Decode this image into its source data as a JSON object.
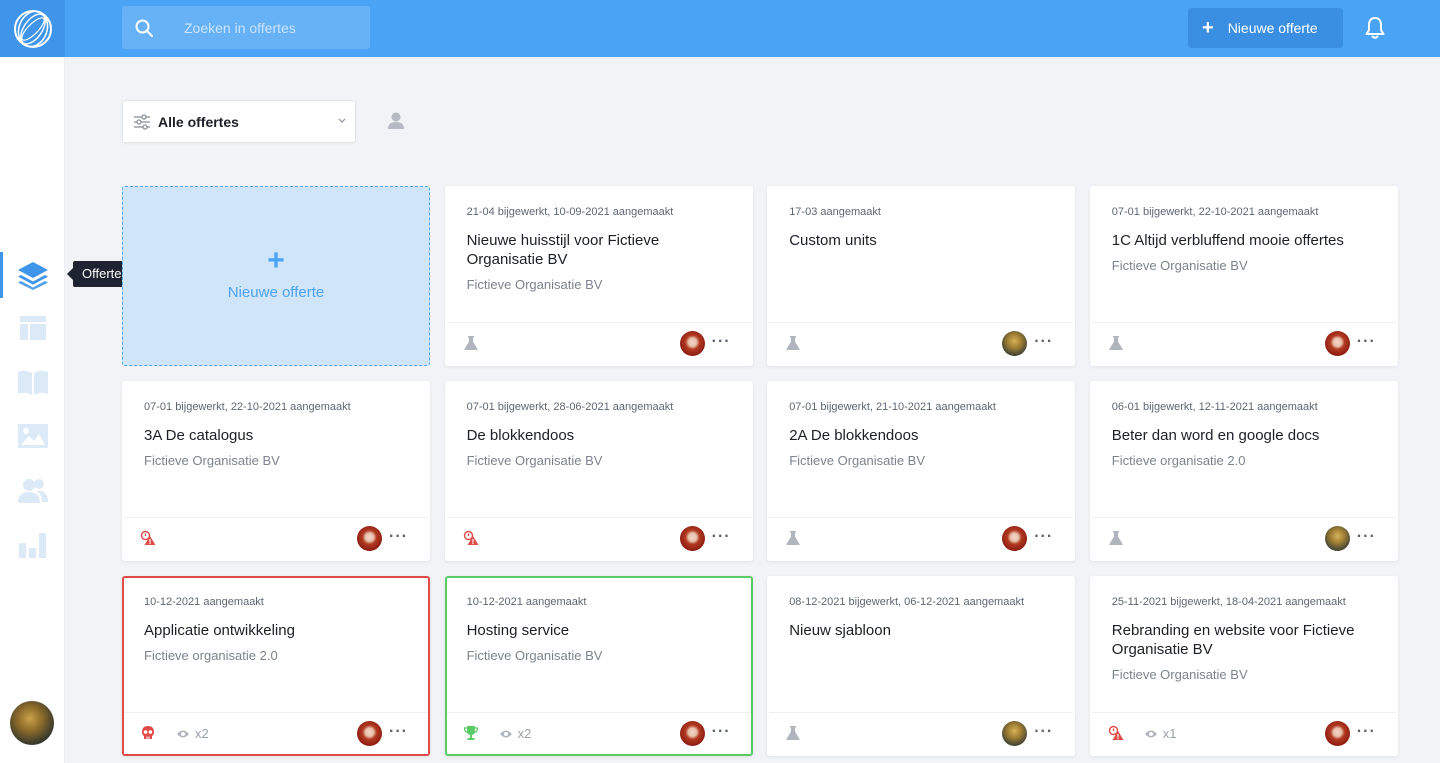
{
  "topbar": {
    "search_placeholder": "Zoeken in offertes",
    "new_button_label": "Nieuwe offerte"
  },
  "sidebar": {
    "items": [
      {
        "name": "offertes",
        "icon": "layers-icon",
        "active": true
      },
      {
        "name": "templates",
        "icon": "layout-icon"
      },
      {
        "name": "catalog",
        "icon": "book-icon"
      },
      {
        "name": "media",
        "icon": "image-icon"
      },
      {
        "name": "contacts",
        "icon": "users-icon"
      },
      {
        "name": "reports",
        "icon": "bar-chart-icon"
      }
    ],
    "tooltip": "Offertes"
  },
  "filter": {
    "selected": "Alle offertes"
  },
  "new_card": {
    "label": "Nieuwe offerte"
  },
  "colors": {
    "accent": "#4ba3f6",
    "lost": "#e04b47",
    "won": "#5acb67"
  },
  "cards": [
    {
      "meta": "21-04 bijgewerkt,  10-09-2021 aangemaakt",
      "title": "Nieuwe huisstijl voor Fictieve Organisatie BV",
      "org": "Fictieve Organisatie BV",
      "status": "draft",
      "avatar": "red",
      "views": ""
    },
    {
      "meta": "17-03 aangemaakt",
      "title": "Custom units",
      "org": "",
      "status": "draft",
      "avatar": "nature",
      "views": ""
    },
    {
      "meta": "07-01 bijgewerkt,  22-10-2021 aangemaakt",
      "title": "1C Altijd verbluffend mooie offertes",
      "org": "Fictieve Organisatie BV",
      "status": "draft",
      "avatar": "red",
      "views": ""
    },
    {
      "meta": "07-01 bijgewerkt,  22-10-2021 aangemaakt",
      "title": "3A De catalogus",
      "org": "Fictieve Organisatie BV",
      "status": "warning",
      "avatar": "red",
      "views": ""
    },
    {
      "meta": "07-01 bijgewerkt,  28-06-2021 aangemaakt",
      "title": "De blokkendoos",
      "org": "Fictieve Organisatie BV",
      "status": "warning",
      "avatar": "red",
      "views": ""
    },
    {
      "meta": "07-01 bijgewerkt,  21-10-2021 aangemaakt",
      "title": "2A De blokkendoos",
      "org": "Fictieve Organisatie BV",
      "status": "draft",
      "avatar": "red",
      "views": ""
    },
    {
      "meta": "06-01 bijgewerkt,  12-11-2021 aangemaakt",
      "title": "Beter dan word en google docs",
      "org": "Fictieve organisatie 2.0",
      "status": "draft",
      "avatar": "nature",
      "views": ""
    },
    {
      "meta": "10-12-2021 aangemaakt",
      "title": "Applicatie ontwikkeling",
      "org": "Fictieve organisatie 2.0",
      "status": "lost",
      "avatar": "red",
      "views": "x2"
    },
    {
      "meta": "10-12-2021 aangemaakt",
      "title": "Hosting service",
      "org": "Fictieve Organisatie BV",
      "status": "won",
      "avatar": "red",
      "views": "x2"
    },
    {
      "meta": "08-12-2021 bijgewerkt,  06-12-2021 aangemaakt",
      "title": "Nieuw sjabloon",
      "org": "",
      "status": "draft",
      "avatar": "nature",
      "views": ""
    },
    {
      "meta": "25-11-2021 bijgewerkt,  18-04-2021 aangemaakt",
      "title": "Rebranding en website voor Fictieve Organisatie BV",
      "org": "Fictieve Organisatie BV",
      "status": "warning",
      "avatar": "red",
      "views": "x1"
    }
  ]
}
